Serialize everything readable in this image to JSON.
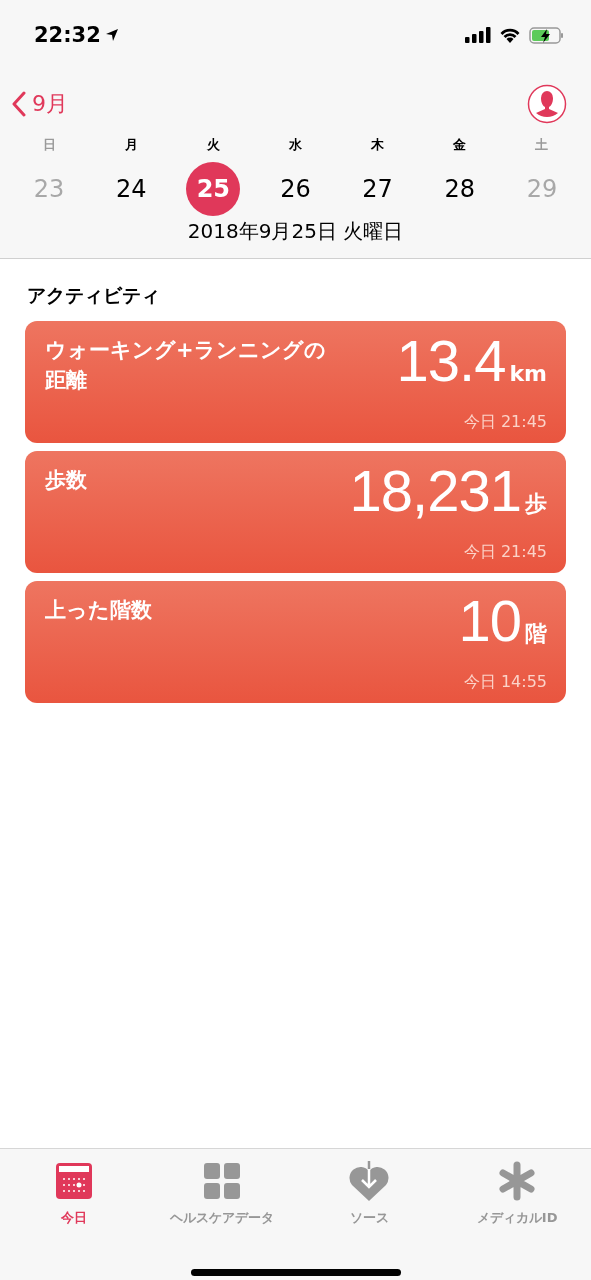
{
  "status_bar": {
    "time": "22:32"
  },
  "nav": {
    "back_label": "9月"
  },
  "week": [
    {
      "weekday": "日",
      "day": "23",
      "weekend": true,
      "selected": false
    },
    {
      "weekday": "月",
      "day": "24",
      "weekend": false,
      "selected": false
    },
    {
      "weekday": "火",
      "day": "25",
      "weekend": false,
      "selected": true
    },
    {
      "weekday": "水",
      "day": "26",
      "weekend": false,
      "selected": false
    },
    {
      "weekday": "木",
      "day": "27",
      "weekend": false,
      "selected": false
    },
    {
      "weekday": "金",
      "day": "28",
      "weekend": false,
      "selected": false
    },
    {
      "weekday": "土",
      "day": "29",
      "weekend": true,
      "selected": false
    }
  ],
  "date_label": "2018年9月25日 火曜日",
  "section_title": "アクティビティ",
  "cards": [
    {
      "title": "ウォーキング+ランニングの距離",
      "value": "13.4",
      "unit": "km",
      "time": "今日 21:45"
    },
    {
      "title": "歩数",
      "value": "18,231",
      "unit": "歩",
      "time": "今日 21:45"
    },
    {
      "title": "上った階数",
      "value": "10",
      "unit": "階",
      "time": "今日 14:55"
    }
  ],
  "tabs": [
    {
      "label": "今日",
      "kind": "calendar",
      "selected": true
    },
    {
      "label": "ヘルスケアデータ",
      "kind": "grid",
      "selected": false
    },
    {
      "label": "ソース",
      "kind": "heart",
      "selected": false
    },
    {
      "label": "メディカルID",
      "kind": "asterisk",
      "selected": false
    }
  ]
}
